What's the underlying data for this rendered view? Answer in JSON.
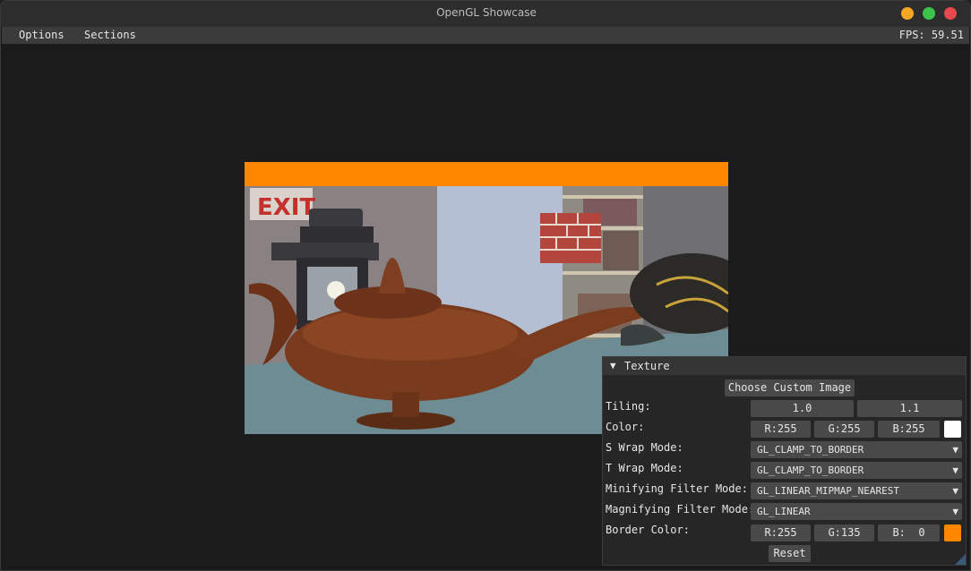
{
  "window": {
    "title": "OpenGL Showcase",
    "colors": {
      "minimize": "#f5a623",
      "maximize": "#3cc34a",
      "close": "#e5484d"
    }
  },
  "menubar": {
    "options": "Options",
    "sections": "Sections",
    "fps": "FPS: 59.51"
  },
  "scene": {
    "border_color": "#ff8700",
    "sign_text": "EXIT"
  },
  "texture_panel": {
    "title": "Texture",
    "choose_image": "Choose Custom Image",
    "tiling_label": "Tiling:",
    "tiling_u": "1.0",
    "tiling_v": "1.1",
    "color_label": "Color:",
    "color_r": "R:255",
    "color_g": "G:255",
    "color_b": "B:255",
    "color_swatch": "#ffffff",
    "s_wrap_label": "S Wrap Mode:",
    "s_wrap_value": "GL_CLAMP_TO_BORDER",
    "t_wrap_label": "T Wrap Mode:",
    "t_wrap_value": "GL_CLAMP_TO_BORDER",
    "min_filter_label": "Minifying Filter Mode:",
    "min_filter_value": "GL_LINEAR_MIPMAP_NEAREST",
    "mag_filter_label": "Magnifying Filter Mode:",
    "mag_filter_value": "GL_LINEAR",
    "border_label": "Border Color:",
    "border_r": "R:255",
    "border_g": "G:135",
    "border_b": "B:  0",
    "border_swatch": "#ff8700",
    "reset": "Reset"
  }
}
